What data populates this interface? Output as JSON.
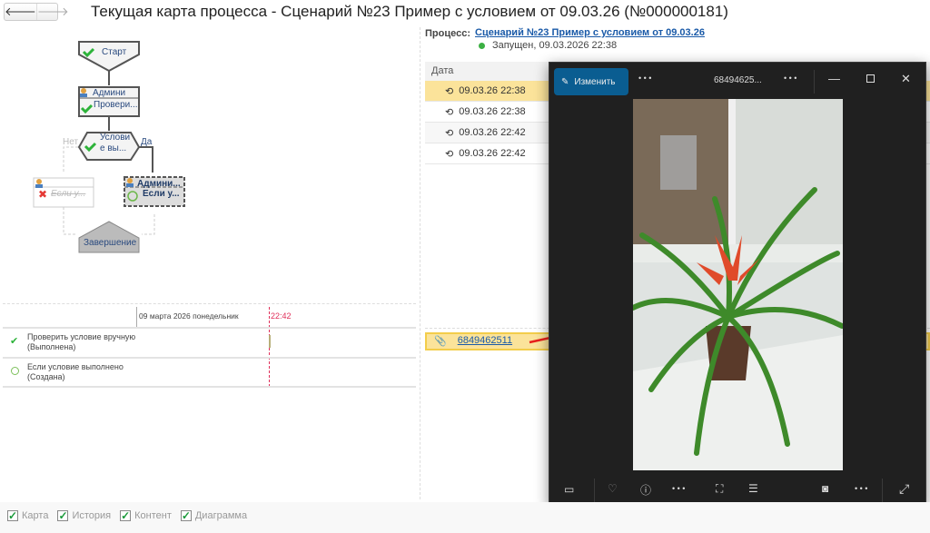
{
  "header": {
    "title": "Текущая карта процесса - Сценарий №23 Пример с условием от 09.03.26 (№000000181)",
    "back_icon": "arrow-left",
    "forward_icon": "arrow-right"
  },
  "map": {
    "start": "Старт",
    "task1_user": "Админи",
    "task1_name": "Провери...",
    "cond": "Услови\nе вы...",
    "cond_line1": "Услови",
    "cond_line2": "е вы...",
    "no": "Нет",
    "yes": "Да",
    "task2_name": "Если у...",
    "task3_user": "Админи...",
    "task3_name": "Если у...",
    "end": "Завершение"
  },
  "timeline": {
    "date": "09 марта 2026 понедельник",
    "now": "22:42",
    "rows": [
      {
        "name": "Проверить условие вручную",
        "state": "(Выполнена)",
        "status": "done"
      },
      {
        "name": "Если условие выполнено",
        "state": "(Создана)",
        "status": "created"
      }
    ]
  },
  "process": {
    "label": "Процесс:",
    "link": "Сценарий №23 Пример с условием от 09.03.26",
    "status": "Запущен, 09.03.2026 22:38",
    "status_color": "#3cb043"
  },
  "history": {
    "column": "Дата",
    "rows": [
      "09.03.26 22:38",
      "09.03.26 22:38",
      "09.03.26 22:42",
      "09.03.26 22:42"
    ]
  },
  "attachment": {
    "name": "6849462511"
  },
  "viewer": {
    "edit": "Изменить",
    "filename": "68494625...",
    "more": "• • •"
  },
  "footer": {
    "checks": [
      {
        "label": "Карта",
        "checked": true
      },
      {
        "label": "История",
        "checked": true
      },
      {
        "label": "Контент",
        "checked": true
      },
      {
        "label": "Диаграмма",
        "checked": true
      }
    ]
  },
  "colors": {
    "highlight": "#fbe39a",
    "accent": "#0a5d91",
    "link": "#1a5aa8"
  }
}
